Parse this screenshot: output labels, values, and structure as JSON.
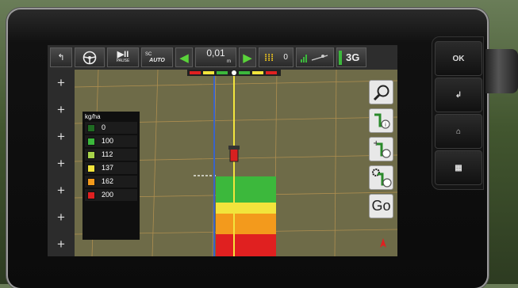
{
  "device": {
    "side_buttons": [
      {
        "label": "OK",
        "icon": "ok"
      },
      {
        "label": "↲",
        "icon": "back-arrow-icon"
      },
      {
        "label": "⌂",
        "icon": "home-icon"
      },
      {
        "label": "▦",
        "icon": "grid-icon"
      }
    ]
  },
  "toolbar": {
    "back_label": "↰",
    "pause_label": "PAUSE",
    "auto_label": "AUTO",
    "auto_prefix": "SC",
    "value": "0,01",
    "value_unit": "m",
    "rows_count": "0",
    "network_label": "3G"
  },
  "legend": {
    "unit": "kg/ha",
    "items": [
      {
        "value": "0",
        "color": "#1f6b22"
      },
      {
        "value": "100",
        "color": "#3cb83c"
      },
      {
        "value": "112",
        "color": "#a8d44a"
      },
      {
        "value": "137",
        "color": "#f2e43c"
      },
      {
        "value": "162",
        "color": "#f39a1c"
      },
      {
        "value": "200",
        "color": "#e02020"
      }
    ]
  },
  "right_tools": {
    "go_label": "Go"
  }
}
